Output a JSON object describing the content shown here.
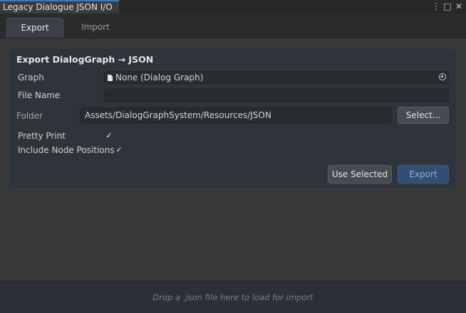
{
  "window": {
    "title": "Legacy Dialogue JSON I/O",
    "controls": {
      "more": "⋮",
      "maximize": "□",
      "close": "✕"
    }
  },
  "tabs": [
    {
      "label": "Export",
      "active": true
    },
    {
      "label": "Import",
      "active": false
    }
  ],
  "export": {
    "title": "Export  DialogGraph → JSON",
    "graph": {
      "label": "Graph",
      "value": "None (Dialog Graph)"
    },
    "file_name": {
      "label": "File Name",
      "value": ""
    },
    "folder": {
      "label": "Folder",
      "value": "Assets/DialogGraphSystem/Resources/JSON",
      "select_label": "Select..."
    },
    "pretty_print": {
      "label": "Pretty Print",
      "checked": true
    },
    "include_node_positions": {
      "label": "Include Node Positions",
      "checked": true
    },
    "buttons": {
      "use_selected": "Use Selected",
      "export": "Export"
    }
  },
  "dropzone": {
    "text": "Drop a .json file here to load for import"
  },
  "colors": {
    "accent": "#3a79bb",
    "primary_button": "#2f4f74"
  }
}
